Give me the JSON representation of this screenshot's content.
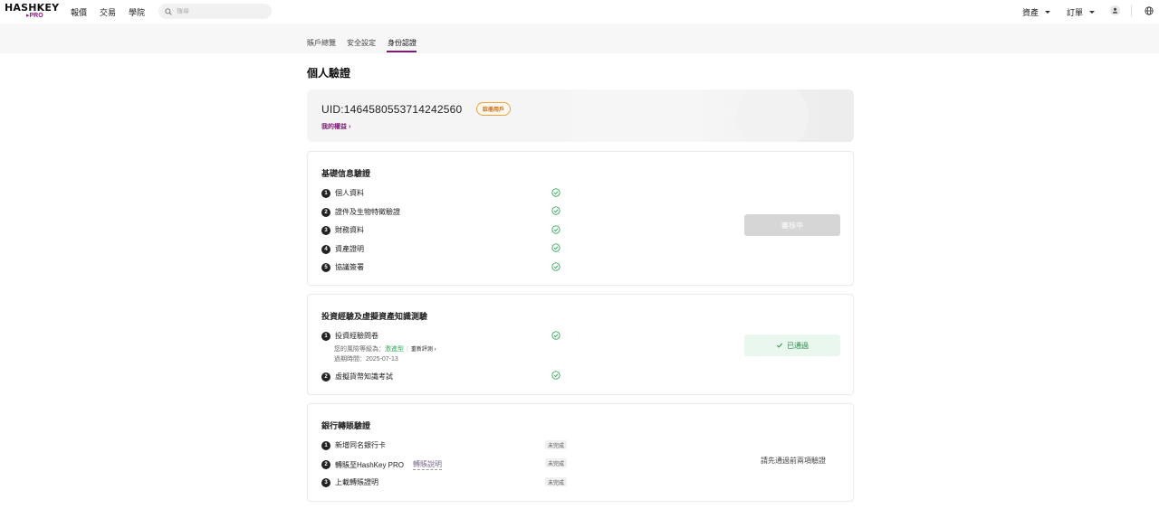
{
  "brand": {
    "name": "HASHKEY",
    "sub": "PRO"
  },
  "nav": {
    "items": [
      "報價",
      "交易",
      "學院"
    ]
  },
  "search": {
    "placeholder": "搜尋"
  },
  "header_right": {
    "assets": "資產",
    "orders": "訂單"
  },
  "tabs": [
    {
      "label": "賬戶總覽",
      "active": false
    },
    {
      "label": "安全設定",
      "active": false
    },
    {
      "label": "身份認證",
      "active": true
    }
  ],
  "page": {
    "title": "個人驗證"
  },
  "uid_card": {
    "uid": "UID:1464580553714242560",
    "badge": "註冊用戶",
    "benefits_link": "我的權益 ›"
  },
  "basic": {
    "title": "基礎信息驗證",
    "steps": [
      "個人資料",
      "證件及生物特徵驗證",
      "財務資料",
      "資產證明",
      "協議簽署"
    ],
    "status": "審核中"
  },
  "invest": {
    "title": "投資經驗及虛擬資產知識測驗",
    "steps": [
      "投資經驗問卷",
      "虛擬貨幣知識考試"
    ],
    "risk_prefix": "您的風險等級為：",
    "risk_level": "激進型",
    "retest": "重新評測 ›",
    "expiry": "過期時間：2025-07-13",
    "status": "已通過"
  },
  "bank": {
    "title": "銀行轉賬驗證",
    "steps": [
      "新增同名銀行卡",
      "轉賬至HashKey PRO",
      "上載轉賬證明"
    ],
    "transfer_link": "轉賬說明",
    "tag": "未完成",
    "note": "請先通過前兩項驗證"
  },
  "colors": {
    "accent": "#7a1a72",
    "success": "#32a857",
    "badge": "#f2a23a"
  }
}
